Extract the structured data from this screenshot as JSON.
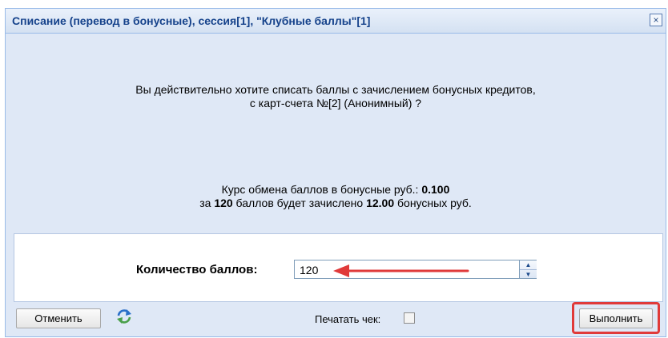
{
  "dialog": {
    "title": "Списание (перевод в бонусные), сессия[1], \"Клубные баллы\"[1]",
    "close_icon": "×"
  },
  "message": {
    "question_line1": "Вы действительно хотите списать баллы с зачислением бонусных кредитов,",
    "question_line2": "с карт-счета №[2] (Анонимный) ?",
    "rate_prefix": "Курс обмена баллов в бонусные руб.: ",
    "rate_value": "0.100",
    "conv_prefix": "за ",
    "conv_points": "120",
    "conv_middle": " баллов будет зачислено ",
    "conv_amount": "12.00",
    "conv_suffix": " бонусных руб."
  },
  "form": {
    "quantity_label": "Количество баллов:",
    "quantity_value": "120"
  },
  "toolbar": {
    "cancel_label": "Отменить",
    "print_label": "Печатать чек:",
    "print_checked": false,
    "execute_label": "Выполнить"
  },
  "colors": {
    "title_text": "#15428b",
    "window_bg": "#dfe8f6",
    "annotation_red": "#e03a3a"
  }
}
